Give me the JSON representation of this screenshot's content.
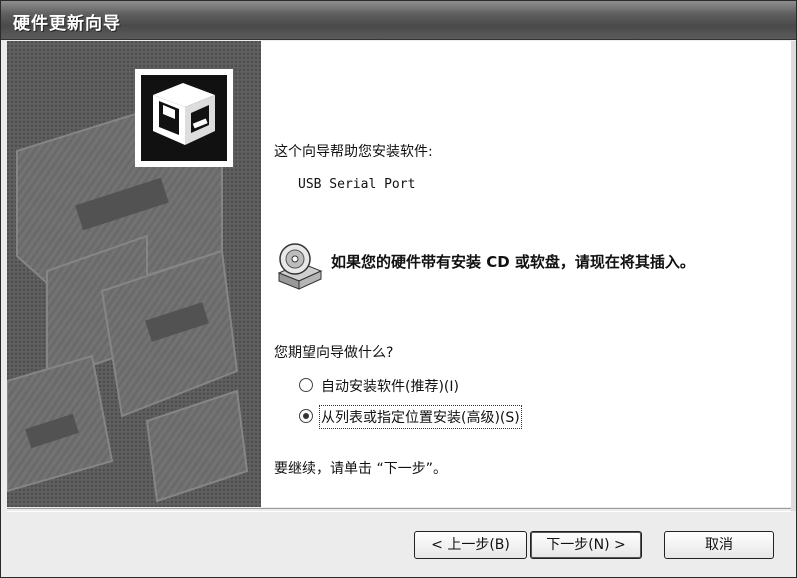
{
  "window": {
    "title": "硬件更新向导"
  },
  "content": {
    "intro": "这个向导帮助您安装软件:",
    "device_name": "USB Serial Port",
    "cd_prompt": "如果您的硬件带有安装 CD 或软盘，请现在将其插入。",
    "question": "您期望向导做什么?",
    "options": [
      {
        "label": "自动安装软件(推荐)(I)",
        "selected": false
      },
      {
        "label": "从列表或指定位置安装(高级)(S)",
        "selected": true
      }
    ],
    "continue_text": "要继续，请单击 “下一步”。"
  },
  "buttons": {
    "back": "< 上一步(B)",
    "next": "下一步(N) >",
    "cancel": "取消"
  },
  "icons": {
    "header": "hardware-drive-icon",
    "cd": "cd-drive-icon"
  }
}
